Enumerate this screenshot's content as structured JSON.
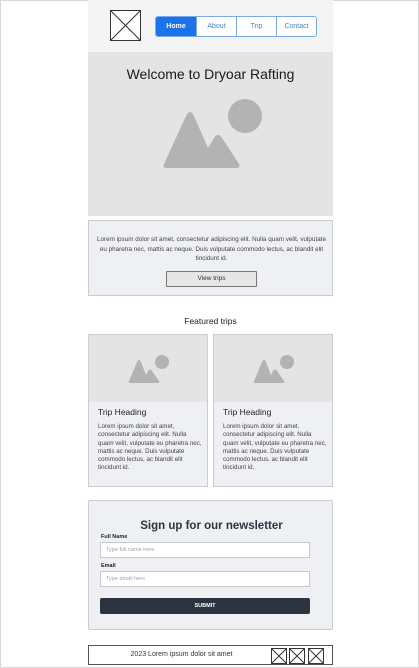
{
  "nav": {
    "items": [
      {
        "label": "Home",
        "active": true
      },
      {
        "label": "About",
        "active": false
      },
      {
        "label": "Trip",
        "active": false
      },
      {
        "label": "Contact",
        "active": false
      }
    ]
  },
  "hero": {
    "title": "Welcome to Dryoar Rafting",
    "image_icon": "image-placeholder-icon"
  },
  "intro": {
    "text": "Lorem ipsum dolor sit amet, consectetur adipiscing elit. Nulla quam velit, vulputate eu pharetra nec, mattis ac neque. Duis vulputate commodo lectus, ac blandit elit tincidunt id.",
    "button_label": "View trips"
  },
  "featured": {
    "title": "Featured trips",
    "cards": [
      {
        "heading": "Trip Heading",
        "text": "Lorem ipsum dolor sit amet, consectetur adipiscing elit. Nulla quam velit, vulputate eu pharetra nec, mattis ac neque. Duis vulputate commodo lectus, ac blandit elit tincidunt id."
      },
      {
        "heading": "Trip Heading",
        "text": "Lorem ipsum dolor sit amet, consectetur adipiscing elit. Nulla quam velit, vulputate eu pharetra nec, mattis ac neque. Duis vulputate commodo lectus, ac blandit elit tincidunt id."
      }
    ]
  },
  "newsletter": {
    "title": "Sign up for our newsletter",
    "name_label": "Full Name",
    "name_placeholder": "Type full name here",
    "email_label": "Email",
    "email_placeholder": "Type email here",
    "submit_label": "SUBMIT"
  },
  "footer": {
    "text": "2023 Lorem ipsum dolor sit amet",
    "social_icons": [
      "social-icon-1",
      "social-icon-2",
      "social-icon-3"
    ]
  },
  "colors": {
    "accent": "#1a73e8",
    "button_dark": "#2b3440",
    "placeholder_gray": "#b3b3b3"
  }
}
